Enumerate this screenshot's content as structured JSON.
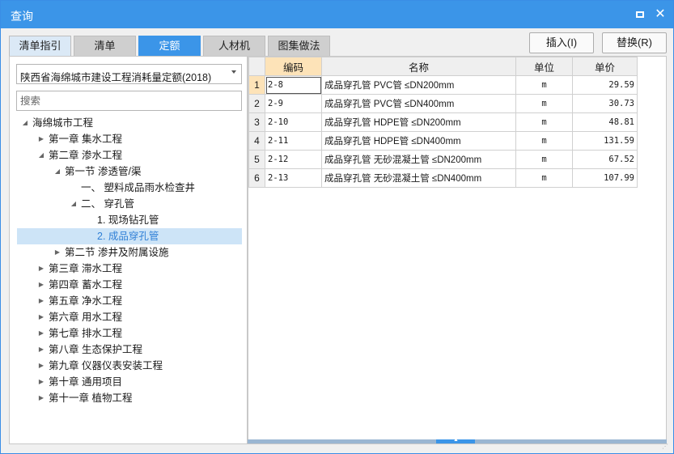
{
  "window": {
    "title": "查询"
  },
  "tabs": [
    "清单指引",
    "清单",
    "定额",
    "人材机",
    "图集做法"
  ],
  "buttons": {
    "insert": "插入(I)",
    "replace": "替换(R)"
  },
  "left": {
    "dropdown_value": "陕西省海绵城市建设工程消耗量定额(2018)",
    "search_placeholder": "搜索"
  },
  "tree": [
    {
      "label": "海绵城市工程",
      "arrow": "▲",
      "level": 0
    },
    {
      "label": "第一章 集水工程",
      "arrow": "▶",
      "level": 1
    },
    {
      "label": "第二章 渗水工程",
      "arrow": "▲",
      "level": 1
    },
    {
      "label": "第一节 渗透管/渠",
      "arrow": "▲",
      "level": 2
    },
    {
      "label": "一、 塑料成品雨水检查井",
      "arrow": "",
      "level": 3
    },
    {
      "label": "二、 穿孔管",
      "arrow": "▲",
      "level": 3
    },
    {
      "label": "1. 现场钻孔管",
      "arrow": "",
      "level": 4
    },
    {
      "label": "2. 成品穿孔管",
      "arrow": "",
      "level": 4,
      "selected": true
    },
    {
      "label": "第二节 渗井及附属设施",
      "arrow": "▶",
      "level": 2
    },
    {
      "label": "第三章 滞水工程",
      "arrow": "▶",
      "level": 1
    },
    {
      "label": "第四章 蓄水工程",
      "arrow": "▶",
      "level": 1
    },
    {
      "label": "第五章 净水工程",
      "arrow": "▶",
      "level": 1
    },
    {
      "label": "第六章 用水工程",
      "arrow": "▶",
      "level": 1
    },
    {
      "label": "第七章 排水工程",
      "arrow": "▶",
      "level": 1
    },
    {
      "label": "第八章 生态保护工程",
      "arrow": "▶",
      "level": 1
    },
    {
      "label": "第九章 仪器仪表安装工程",
      "arrow": "▶",
      "level": 1
    },
    {
      "label": "第十章 通用项目",
      "arrow": "▶",
      "level": 1
    },
    {
      "label": "第十一章 植物工程",
      "arrow": "▶",
      "level": 1
    }
  ],
  "grid": {
    "columns": [
      "编码",
      "名称",
      "单位",
      "单价"
    ],
    "rows": [
      {
        "num": "1",
        "code": "2-8",
        "name": "成品穿孔管 PVC管 ≤DN200mm",
        "unit": "m",
        "price": "29.59"
      },
      {
        "num": "2",
        "code": "2-9",
        "name": "成品穿孔管 PVC管 ≤DN400mm",
        "unit": "m",
        "price": "30.73"
      },
      {
        "num": "3",
        "code": "2-10",
        "name": "成品穿孔管 HDPE管 ≤DN200mm",
        "unit": "m",
        "price": "48.81"
      },
      {
        "num": "4",
        "code": "2-11",
        "name": "成品穿孔管 HDPE管 ≤DN400mm",
        "unit": "m",
        "price": "131.59"
      },
      {
        "num": "5",
        "code": "2-12",
        "name": "成品穿孔管 无砂混凝土管 ≤DN200mm",
        "unit": "m",
        "price": "67.52"
      },
      {
        "num": "6",
        "code": "2-13",
        "name": "成品穿孔管 无砂混凝土管 ≤DN400mm",
        "unit": "m",
        "price": "107.99"
      }
    ]
  },
  "colors": {
    "accent": "#3b95e8",
    "selected_bg": "#cde4f7",
    "sorted_header": "#fde3b8"
  }
}
